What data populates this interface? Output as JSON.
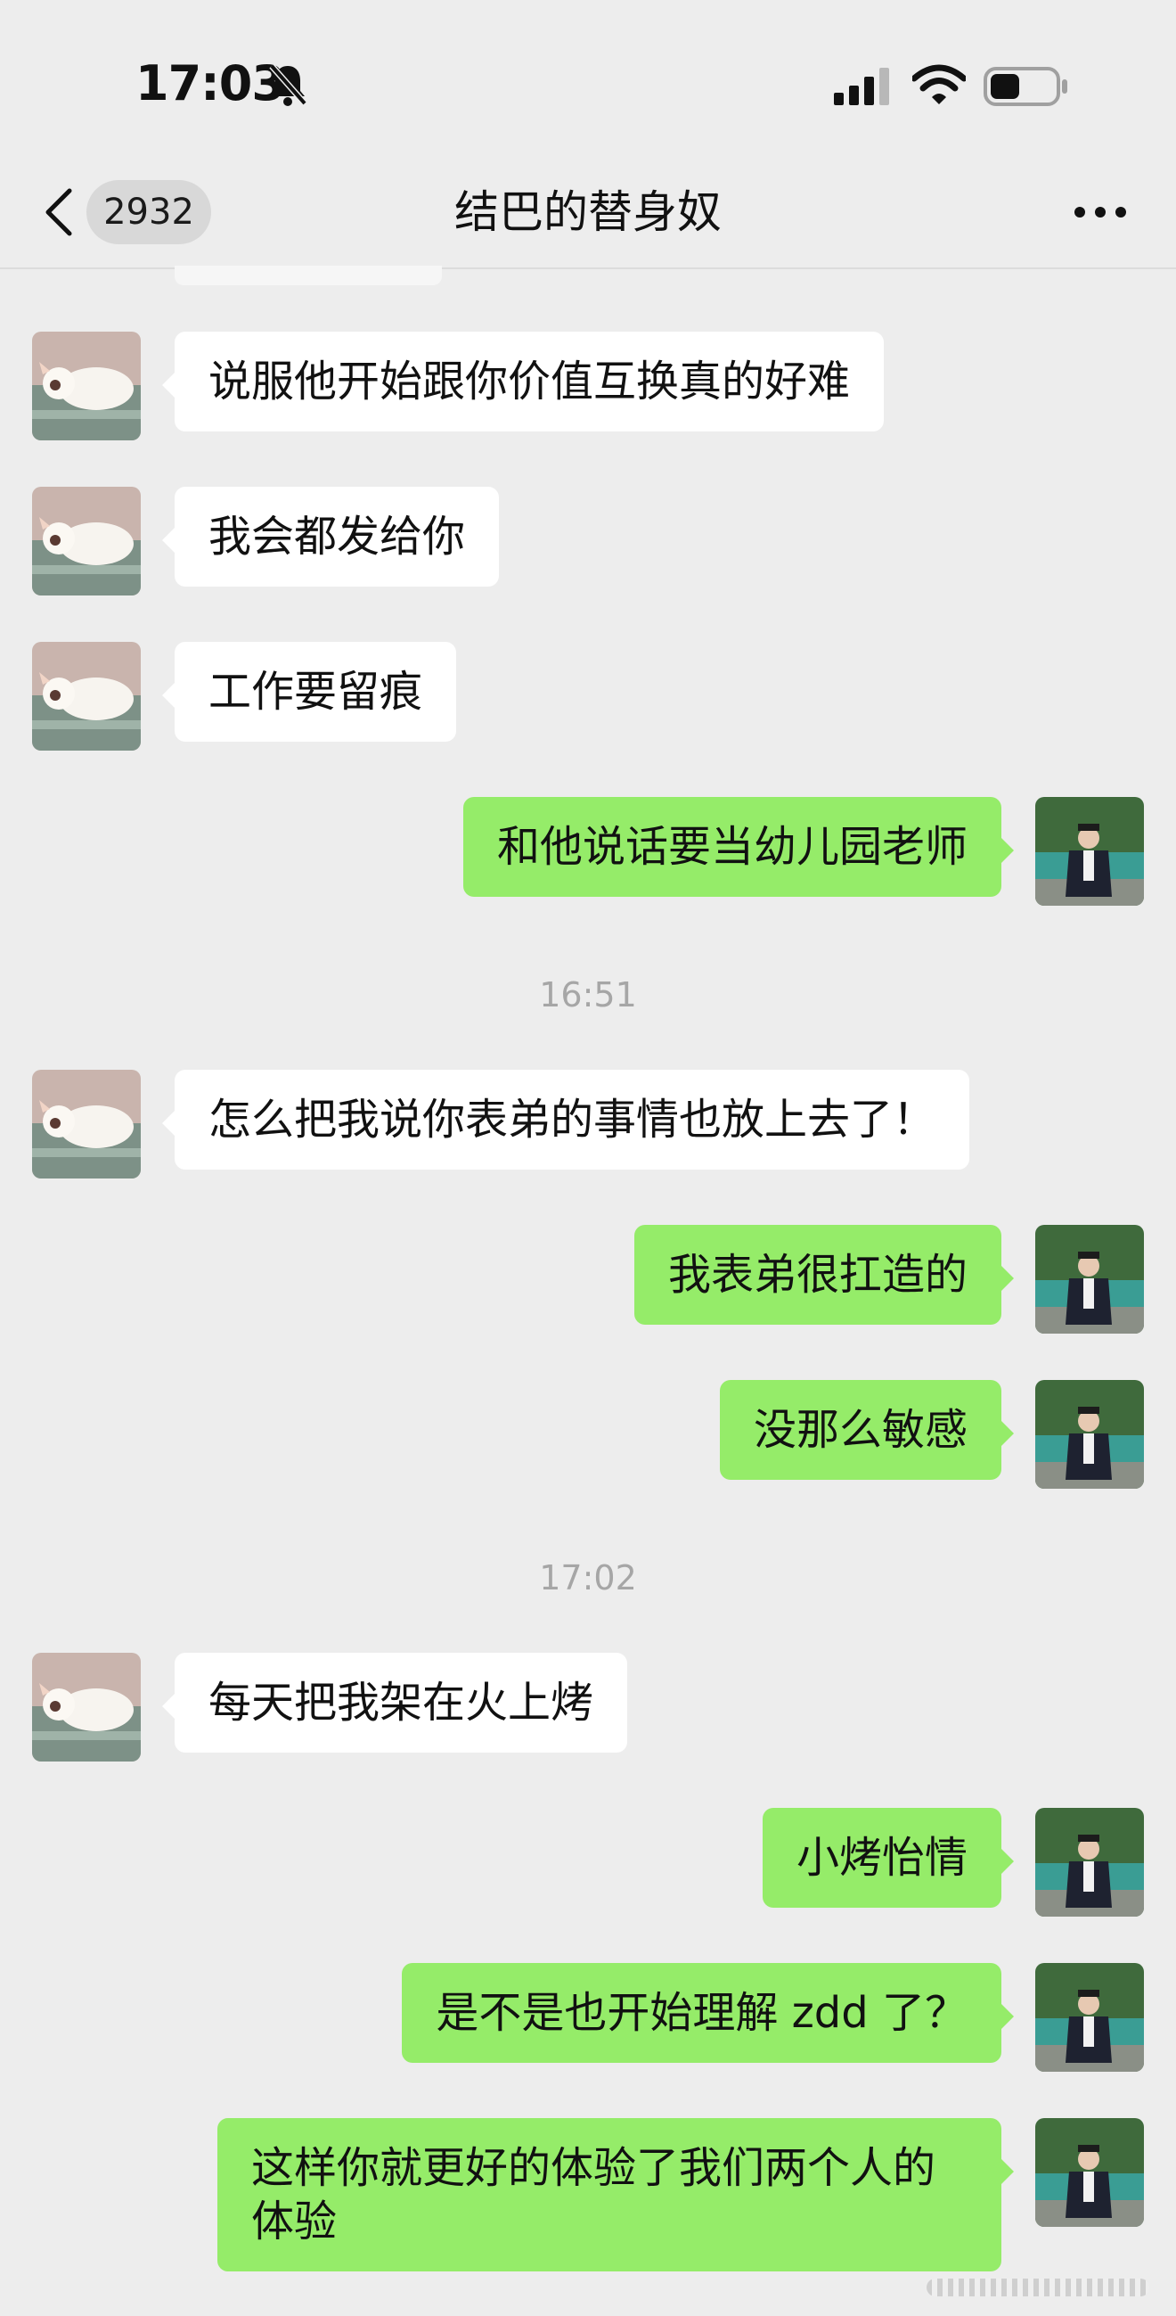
{
  "status_bar": {
    "time": "17:03",
    "icons": [
      "bell-slash-icon",
      "cellular-signal-icon",
      "wifi-icon",
      "battery-icon"
    ]
  },
  "nav": {
    "unread_count": "2932",
    "title": "结巴的替身奴",
    "icons": [
      "chevron-left-icon",
      "more-icon"
    ]
  },
  "colors": {
    "background": "#ededed",
    "incoming_bubble": "#ffffff",
    "outgoing_bubble": "#95ec69",
    "timestamp_text": "#a6a6a6"
  },
  "messages": [
    {
      "side": "in",
      "text": "说服他开始跟你价值互换真的好难"
    },
    {
      "side": "in",
      "text": "我会都发给你"
    },
    {
      "side": "in",
      "text": "工作要留痕"
    },
    {
      "side": "out",
      "text": "和他说话要当幼儿园老师"
    },
    {
      "type": "time",
      "text": "16:51"
    },
    {
      "side": "in",
      "text": "怎么把我说你表弟的事情也放上去了！"
    },
    {
      "side": "out",
      "text": "我表弟很扛造的"
    },
    {
      "side": "out",
      "text": "没那么敏感"
    },
    {
      "type": "time",
      "text": "17:02"
    },
    {
      "side": "in",
      "text": "每天把我架在火上烤"
    },
    {
      "side": "out",
      "text": "小烤怡情"
    },
    {
      "side": "out",
      "text": "是不是也开始理解 zdd 了？"
    },
    {
      "side": "out",
      "text": "这样你就更好的体验了我们两个人的体验"
    }
  ]
}
